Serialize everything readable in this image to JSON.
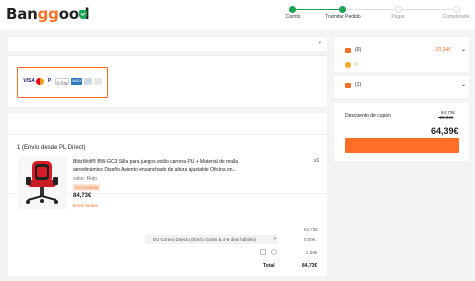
{
  "header": {
    "logo_part1": "Ban",
    "logo_part2": "gg",
    "logo_part3": "ood",
    "steps": [
      "Carrito",
      "Tramitar Pedido",
      "Pagar",
      "Completada"
    ]
  },
  "payment": {
    "methods": [
      "VISA",
      "MC",
      "P",
      "G Pay",
      "AMEX",
      "",
      ""
    ]
  },
  "order": {
    "section_title": "1 (Envío desde PL Direct)",
    "product": {
      "name": "BlitzWolf® BW-GC3 Silla para juegos estilo carrera PU + Material de malla aerodinámico Diseño Asiento ensanchado de altura ajustable Oficina en...",
      "color": "color: Rojo",
      "vat_badge": "IVA Incluida",
      "price": "84,73€",
      "shipping_note": "Envío Gratis",
      "qty": "x1"
    },
    "subtotal": "84,73€",
    "shipping_method": "EU Correo Directo (Envío Gratis & 4-6 días hábiles)",
    "shipping_cost": "0,00€",
    "insurance_cost": "1,69€",
    "total_label": "Total",
    "total_value": "84,73€"
  },
  "summary": {
    "row1_label": "(0)",
    "row1_value": "-20,34€",
    "row2_label": "0",
    "row3_label": "(1)",
    "coupon_label": "Descuento de cupón",
    "coupon_old1": "84,73€",
    "coupon_old2": "-20,34€",
    "total": "64,39€"
  },
  "colors": {
    "accent": "#ff6e26",
    "progress_green": "#1aa350"
  }
}
